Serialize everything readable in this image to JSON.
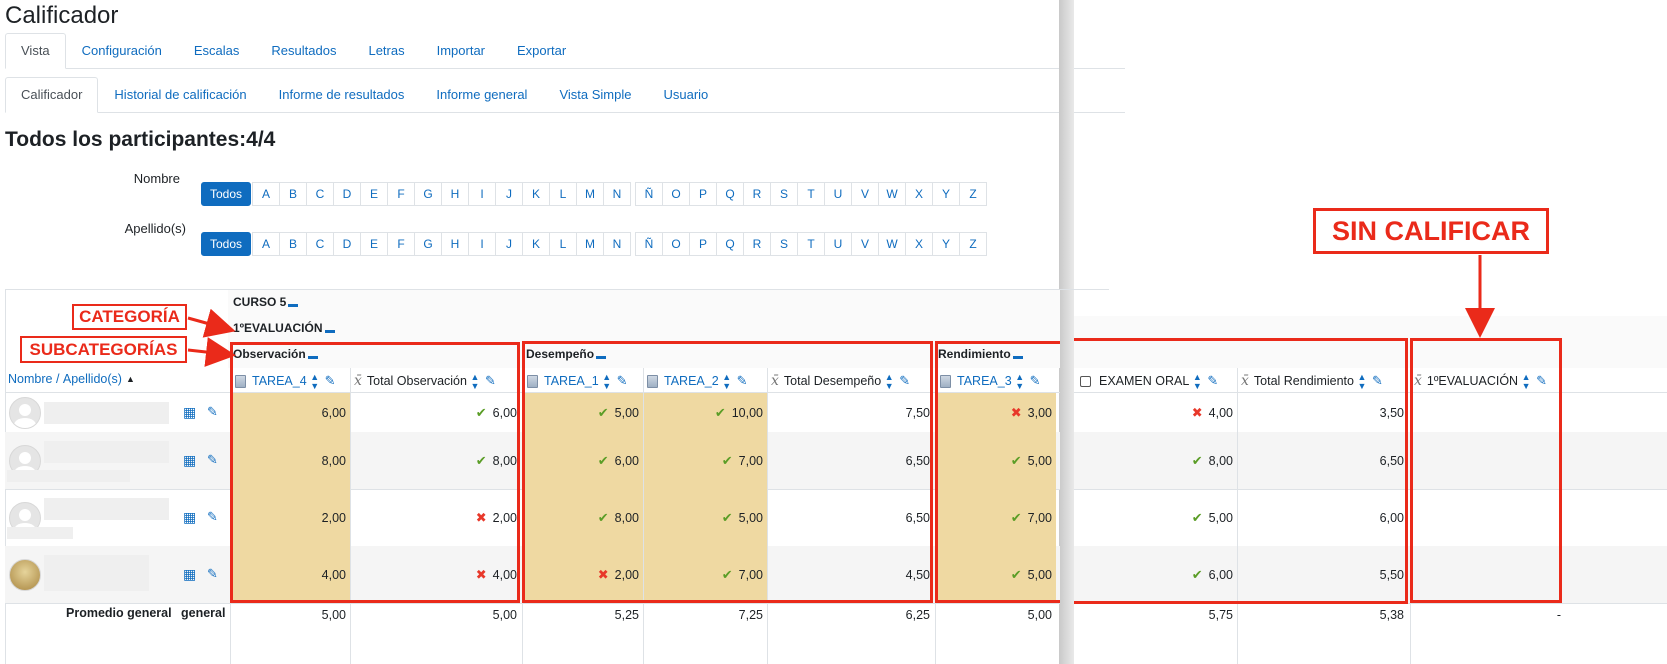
{
  "page_title": "Calificador",
  "tabs_main": [
    "Vista",
    "Configuración",
    "Escalas",
    "Resultados",
    "Letras",
    "Importar",
    "Exportar"
  ],
  "tabs_sub": [
    "Calificador",
    "Historial de calificación",
    "Informe de resultados",
    "Informe general",
    "Vista Simple",
    "Usuario"
  ],
  "participants": "Todos los participantes:4/4",
  "filters": {
    "first_name_label": "Nombre",
    "last_name_label": "Apellido(s)",
    "all_label": "Todos",
    "letters": [
      "A",
      "B",
      "C",
      "D",
      "E",
      "F",
      "G",
      "H",
      "I",
      "J",
      "K",
      "L",
      "M",
      "N",
      "Ñ",
      "O",
      "P",
      "Q",
      "R",
      "S",
      "T",
      "U",
      "V",
      "W",
      "X",
      "Y",
      "Z"
    ]
  },
  "grader": {
    "course": "CURSO 5",
    "category": "1ºEVALUACIÓN",
    "subcategories": [
      "Observación",
      "Desempeño",
      "Rendimiento"
    ],
    "name_header_first": "Nombre",
    "name_header_sep": " / ",
    "name_header_last": "Apellido(s)",
    "columns": [
      {
        "label": "TAREA_4",
        "kind": "assign"
      },
      {
        "label": "Total Observación",
        "kind": "total"
      },
      {
        "label": "TAREA_1",
        "kind": "assign"
      },
      {
        "label": "TAREA_2",
        "kind": "assign"
      },
      {
        "label": "Total Desempeño",
        "kind": "total"
      },
      {
        "label": "TAREA_3",
        "kind": "assign"
      },
      {
        "label": "EXAMEN ORAL",
        "kind": "checkbox"
      },
      {
        "label": "Total Rendimiento",
        "kind": "total"
      },
      {
        "label": "1ºEVALUACIÓN",
        "kind": "total"
      }
    ],
    "rows": [
      [
        "6,00",
        "6,00",
        "5,00",
        "10,00",
        "7,50",
        "3,00",
        "4,00",
        "3,50",
        ""
      ],
      [
        "8,00",
        "8,00",
        "6,00",
        "7,00",
        "6,50",
        "5,00",
        "8,00",
        "6,50",
        ""
      ],
      [
        "2,00",
        "2,00",
        "8,00",
        "5,00",
        "6,50",
        "7,00",
        "5,00",
        "6,00",
        ""
      ],
      [
        "4,00",
        "4,00",
        "2,00",
        "7,00",
        "4,50",
        "5,00",
        "6,00",
        "5,50",
        ""
      ]
    ],
    "marks": [
      [
        "",
        "check",
        "check",
        "check",
        "",
        "cross",
        "cross",
        "",
        ""
      ],
      [
        "",
        "check",
        "check",
        "check",
        "",
        "check",
        "check",
        "",
        ""
      ],
      [
        "",
        "cross",
        "check",
        "check",
        "",
        "check",
        "check",
        "",
        ""
      ],
      [
        "",
        "cross",
        "cross",
        "check",
        "",
        "check",
        "check",
        "",
        ""
      ]
    ],
    "average_label": "Promedio general",
    "average_label_2": "general",
    "averages": [
      "5,00",
      "5,00",
      "5,25",
      "7,25",
      "6,25",
      "5,00",
      "5,75",
      "5,38",
      "-"
    ]
  },
  "annotations": {
    "categoria": "CATEGORÍA",
    "subcategorias": "SUBCATEGORÍAS",
    "sin_calificar": "SIN CALIFICAR"
  },
  "colors": {
    "accent": "#0f6cbf",
    "annotation": "#ea2a1a",
    "highlight": "#efd9a2"
  }
}
